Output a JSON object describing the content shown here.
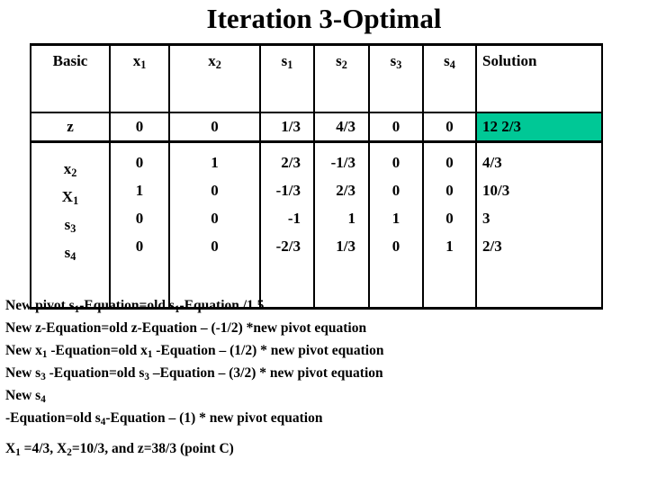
{
  "title": "Iteration 3-Optimal",
  "accent_green": "#00c896",
  "table": {
    "columns": [
      "Basic",
      "x",
      "x",
      "s",
      "s",
      "s",
      "s",
      "Solution"
    ],
    "headers": [
      {
        "text": "Basic",
        "sub": "",
        "align": "center"
      },
      {
        "text": "x",
        "sub": "1",
        "align": "center"
      },
      {
        "text": "x",
        "sub": "2",
        "align": "center"
      },
      {
        "text": "s",
        "sub": "1",
        "align": "center"
      },
      {
        "text": "s",
        "sub": "2",
        "align": "center"
      },
      {
        "text": "s",
        "sub": "3",
        "align": "center"
      },
      {
        "text": "s",
        "sub": "4",
        "align": "center"
      },
      {
        "text": "Solution",
        "sub": "",
        "align": "left"
      }
    ],
    "z_row": {
      "basic": "z",
      "basic_sub": "",
      "x1": "0",
      "x2": "0",
      "s1": "1/3",
      "s2": "4/3",
      "s3": "0",
      "s4": "0",
      "solution": "12 2/3",
      "solution_highlighted": true
    },
    "body_rows": [
      {
        "basic": "x",
        "basic_sub": "2",
        "x1": "0",
        "x2": "1",
        "s1": "2/3",
        "s2": "-1/3",
        "s3": "0",
        "s4": "0",
        "solution": "4/3"
      },
      {
        "basic": "X",
        "basic_sub": "1",
        "x1": "1",
        "x2": "0",
        "s1": "-1/3",
        "s2": "2/3",
        "s3": "0",
        "s4": "0",
        "solution": "10/3"
      },
      {
        "basic": "s",
        "basic_sub": "3",
        "x1": "0",
        "x2": "0",
        "s1": "-1",
        "s2": "1",
        "s3": "1",
        "s4": "0",
        "solution": "3"
      },
      {
        "basic": "s",
        "basic_sub": "4",
        "x1": "0",
        "x2": "0",
        "s1": "-2/3",
        "s2": "1/3",
        "s3": "0",
        "s4": "1",
        "solution": "2/3"
      }
    ]
  },
  "notes": [
    {
      "id": "note-pivot",
      "parts": [
        {
          "t": "New pivot s"
        },
        {
          "sub": "1"
        },
        {
          "t": "-Equation=old s"
        },
        {
          "sub": "1"
        },
        {
          "t": "-Equation /1.5"
        }
      ]
    },
    {
      "id": "note-z",
      "parts": [
        {
          "t": "New z-Equation=old z-Equation – (-1/2) *new pivot equation"
        }
      ]
    },
    {
      "id": "note-x1",
      "parts": [
        {
          "t": "New x"
        },
        {
          "sub": "1"
        },
        {
          "t": " -Equation=old x"
        },
        {
          "sub": "1"
        },
        {
          "t": " -Equation – (1/2) * new pivot equation"
        }
      ]
    },
    {
      "id": "note-s3",
      "parts": [
        {
          "t": "New s"
        },
        {
          "sub": "3"
        },
        {
          "t": " -Equation=old s"
        },
        {
          "sub": "3"
        },
        {
          "t": " –Equation – (3/2) * new pivot equation"
        }
      ]
    },
    {
      "id": "note-s4-a",
      "parts": [
        {
          "t": "New s"
        },
        {
          "sub": "4"
        }
      ]
    },
    {
      "id": "note-s4-b",
      "parts": [
        {
          "t": "-Equation=old s"
        },
        {
          "sub": "4"
        },
        {
          "t": "-Equation – (1) * new pivot equation"
        }
      ]
    },
    {
      "id": "note-result",
      "gap": true,
      "parts": [
        {
          "t": "X"
        },
        {
          "sub": "1"
        },
        {
          "t": " =4/3, X"
        },
        {
          "sub": "2"
        },
        {
          "t": "=10/3, and z=38/3 (point C)"
        }
      ]
    }
  ]
}
